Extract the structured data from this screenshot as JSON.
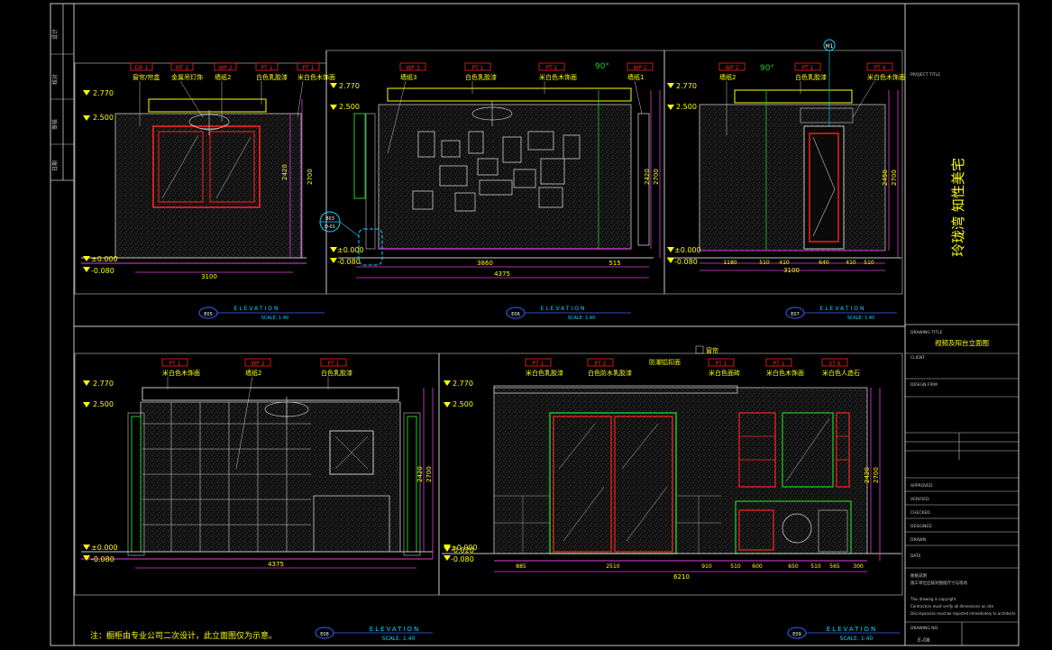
{
  "sheet": {
    "title_vertical": "玲珑湾 知性美宅",
    "note": "注：橱柜由专业公司二次设计，此立面图仅为示意。",
    "drawing_title": "视频及阳台立面图",
    "labels": {
      "project_title": "PROJECT TITLE",
      "drawing_title": "DRAWING TITLE",
      "client": "CLIENT",
      "design_firm": "DESIGN FIRM",
      "approved": "APPROVED",
      "verified": "VERIFIED",
      "checked": "CHECKED",
      "designed": "DESIGNED",
      "drawn": "DRAWN",
      "date": "DATE",
      "drawing_no": "DRAWING NO."
    },
    "notes_block": [
      "图纸说明",
      "施工单位应核对图纸尺寸与现场",
      "This drawing is copyright",
      "Contractors must verify all dimensions on site",
      "Discrepancies must be reported immediately to architects"
    ],
    "sheet_no": "E-08",
    "left_strip": [
      "设计",
      "校对",
      "审核",
      "日期"
    ]
  },
  "elevations": [
    {
      "id": "E05",
      "caption": "ELEVATION",
      "scale": "SCALE:  1:40",
      "levels": [
        "2.770",
        "2.500",
        "±0.000",
        "-0.080"
      ],
      "tags": [
        {
          "code": "DR 1",
          "text": "窗帘/帘盒"
        },
        {
          "code": "MT 2",
          "text": "金属吊灯饰"
        },
        {
          "code": "WP 2",
          "text": "墙纸2"
        },
        {
          "code": "PT 1",
          "text": "白色乳胶漆"
        },
        {
          "code": "PT 1",
          "text": "米白色木饰面"
        }
      ],
      "dims": {
        "width": "3100",
        "height_1": "2420",
        "height_2": "2700"
      }
    },
    {
      "id": "E06",
      "caption": "ELEVATION",
      "scale": "SCALE:  1:40",
      "levels": [
        "2.770",
        "2.500",
        "±0.000",
        "-0.080"
      ],
      "tags": [
        {
          "code": "WP 3",
          "text": "墙纸3"
        },
        {
          "code": "PT 1",
          "text": "白色乳胶漆"
        },
        {
          "code": "PT 1",
          "text": "米白色木饰面"
        },
        {
          "code": "WP 1",
          "text": "墙纸1"
        }
      ],
      "angle": "90°",
      "callout": {
        "top": "B03",
        "bottom": "D-01"
      },
      "dims": {
        "width": "4375",
        "part_1": "3860",
        "part_2": "515",
        "height_1": "2420",
        "height_2": "2700"
      }
    },
    {
      "id": "E07",
      "caption": "ELEVATION",
      "scale": "SCALE:  1:40",
      "levels": [
        "2.770",
        "2.500",
        "±0.000",
        "-0.080"
      ],
      "tags": [
        {
          "code": "WP 2",
          "text": "墙纸2"
        },
        {
          "code": "PT 1",
          "text": "白色乳胶漆"
        },
        {
          "code": "PT 4",
          "text": "米白色木饰面"
        }
      ],
      "angle": "90°",
      "marker": "M1",
      "dims": {
        "width": "3100",
        "segments": [
          "1180",
          "510",
          "410",
          "640",
          "410",
          "510"
        ],
        "height_1": "2450",
        "height_2": "2700"
      }
    },
    {
      "id": "E08",
      "caption": "ELEVATION",
      "scale": "SCALE:  1:40",
      "levels": [
        "2.770",
        "2.500",
        "±0.000",
        "-0.080"
      ],
      "tags": [
        {
          "code": "PT 1",
          "text": "米白色木饰面"
        },
        {
          "code": "WP 2",
          "text": "墙纸2"
        },
        {
          "code": "PT 1",
          "text": "白色乳胶漆"
        }
      ],
      "dims": {
        "width": "4375",
        "height_1": "2420",
        "height_2": "2700"
      }
    },
    {
      "id": "E09",
      "caption": "ELEVATION",
      "scale": "SCALE:  1:40",
      "levels": [
        "2.770",
        "2.500",
        "±0.000",
        "-0.020",
        "-0.080"
      ],
      "tags": [
        {
          "code": "PT 1",
          "text": "米白色乳胶漆"
        },
        {
          "code": "PT 2",
          "text": "白色防水乳胶漆"
        },
        {
          "code": "",
          "text": "防潮铝扣面"
        },
        {
          "code": "PT 1",
          "text": "米白色面砖"
        },
        {
          "code": "PT 1",
          "text": "米白色木饰面"
        },
        {
          "code": "ST 6",
          "text": "米白色人造石"
        }
      ],
      "extra_tag": "窗帘",
      "dims": {
        "width": "6210",
        "segments": [
          "885",
          "2510",
          "910",
          "510",
          "600",
          "650",
          "510",
          "565",
          "300"
        ],
        "height_1": "2420",
        "height_2": "2700"
      }
    }
  ],
  "colors": {
    "background": "#000000",
    "frame": "#c8c8c8",
    "red": "#ff2020",
    "yellow": "#ffff00",
    "magenta": "#e040e0",
    "green": "#22cc22",
    "cyan": "#00d8ff",
    "white": "#ffffff",
    "blue": "#3a66ff"
  }
}
